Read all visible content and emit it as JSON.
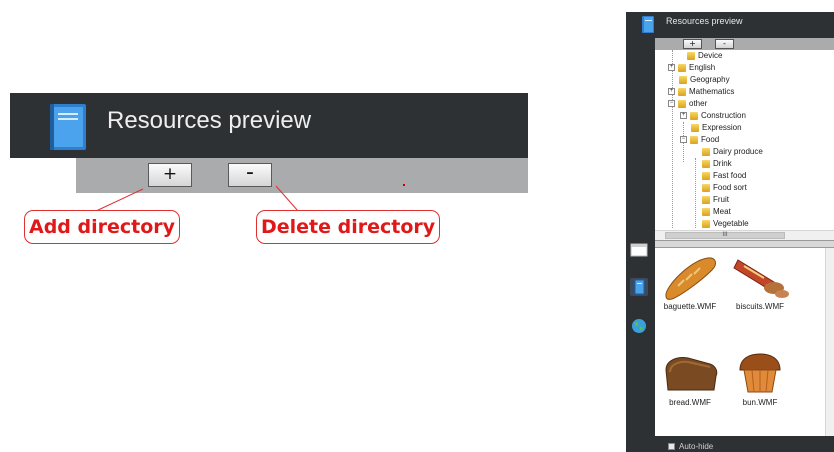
{
  "zoom": {
    "title": "Resources preview",
    "add_label": "+",
    "delete_label": "-"
  },
  "callouts": {
    "add": "Add directory",
    "delete": "Delete directory"
  },
  "panel": {
    "title": "Resources preview",
    "add_label": "+",
    "delete_label": "-",
    "tree": [
      {
        "label": "Device",
        "toggle": ""
      },
      {
        "label": "English",
        "toggle": "+"
      },
      {
        "label": "Geography",
        "toggle": ""
      },
      {
        "label": "Mathematics",
        "toggle": "+"
      },
      {
        "label": "other",
        "toggle": "−"
      },
      {
        "label": "Construction",
        "toggle": "+"
      },
      {
        "label": "Expression",
        "toggle": ""
      },
      {
        "label": "Food",
        "toggle": "−"
      },
      {
        "label": "Dairy produce",
        "toggle": ""
      },
      {
        "label": "Drink",
        "toggle": ""
      },
      {
        "label": "Fast food",
        "toggle": ""
      },
      {
        "label": "Food sort",
        "toggle": ""
      },
      {
        "label": "Fruit",
        "toggle": ""
      },
      {
        "label": "Meat",
        "toggle": ""
      },
      {
        "label": "Vegetable",
        "toggle": ""
      }
    ],
    "hscroll_thumb": "III",
    "resources": [
      "baguette.WMF",
      "biscuits.WMF",
      "bread.WMF",
      "bun.WMF"
    ],
    "autohide_label": "Auto-hide"
  },
  "colors": {
    "header_bg": "#2e3134",
    "toolbar_bg": "#a9abad",
    "callout_red": "#e01818",
    "book_blue": "#3a8fd8"
  }
}
